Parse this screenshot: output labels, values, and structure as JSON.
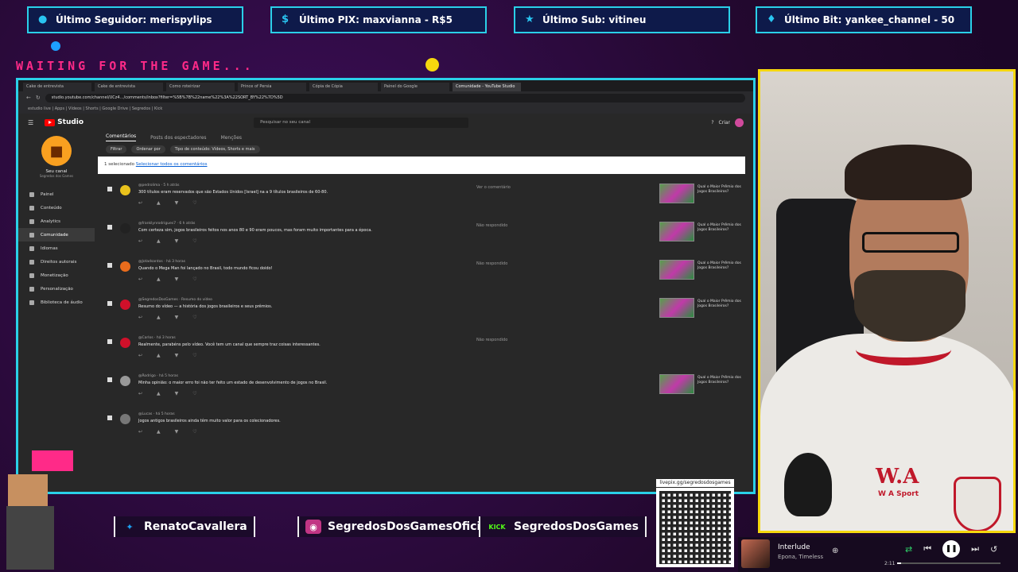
{
  "alerts": [
    {
      "icon": "user-icon",
      "text": "Último Seguidor: merispylips"
    },
    {
      "icon": "pix-icon",
      "text": "Último PIX: maxvianna - R$5"
    },
    {
      "icon": "star-icon",
      "text": "Último Sub: vitineu"
    },
    {
      "icon": "diamond-icon",
      "text": "Último Bit: yankee_channel - 50"
    }
  ],
  "waiting_text": "WAITING FOR THE GAME...",
  "browser": {
    "tabs": [
      "Cake de entrevista",
      "Cake de entrevista",
      "Como roteirizar",
      "Prince of Persia",
      "Cópia de Cópia",
      "Painel do Google",
      "Comunidade - YouTube Studio"
    ],
    "url": "studio.youtube.com/channel/UCz4…/comments/inbox?filter=%5B%7B%22name%22%3A%22SORT_BY%22%7D%5D",
    "bookmarks": "estudio live | Apps | Vídeos | Shorts | Google Drive | Segredos | Kick",
    "studio": {
      "logo": "Studio",
      "search_placeholder": "Pesquisar no seu canal",
      "create": "Criar",
      "channel_name": "Seu canal",
      "channel_sub": "Segredos dos Games",
      "nav": [
        "Painel",
        "Conteúdo",
        "Analytics",
        "Comunidade",
        "Idiomas",
        "Direitos autorais",
        "Monetização",
        "Personalização",
        "Biblioteca de áudio"
      ],
      "subtabs": [
        "Comentários",
        "Posts dos espectadores",
        "Menções"
      ],
      "filters": [
        "Filtrar",
        "Ordenar por",
        "Tipo de conteúdo: Vídeos, Shorts e mais"
      ],
      "banner_prefix": "1 selecionado",
      "banner_link": "Selecionar todos os comentários",
      "comments": [
        {
          "author": "@pedrolima · 5 h atrás",
          "text": "300 títulos eram reservados que são Estados Unidos [Israel] na a 9 títulos brasileiros de 60-80.",
          "status": "Ver o comentário",
          "video": "Qual o Maior Prêmio dos Jogos Brasileiros?",
          "avatar_color": "#e9c21c"
        },
        {
          "author": "@franklynrodrigues7 · 6 h atrás",
          "text": "Com certeza sim, jogos brasileiros feitos nos anos 80 e 90 eram poucos, mas foram muito importantes para a época.",
          "status": "Não respondido",
          "video": "Qual o Maior Prêmio dos Jogos Brasileiros?",
          "avatar_color": "#222"
        },
        {
          "author": "@Jotadsantos · há 3 horas",
          "text": "Quando o Mega Man foi lançado no Brasil, todo mundo ficou doido!",
          "status": "Não respondido",
          "video": "Qual o Maior Prêmio dos Jogos Brasileiros?",
          "avatar_color": "#e96c1c"
        },
        {
          "author": "@SegredosDosGames · Resumo do vídeo",
          "text": "Resumo do vídeo — a história dos jogos brasileiros e seus prêmios.",
          "status": "",
          "video": "Qual o Maior Prêmio dos Jogos Brasileiros?",
          "avatar_color": "#d0102a"
        },
        {
          "author": "@Carlos · há 3 horas",
          "text": "Realmente, parabéns pelo vídeo. Você tem um canal que sempre traz coisas interessantes.",
          "status": "Não respondido",
          "video": "",
          "avatar_color": "#d0102a"
        },
        {
          "author": "@Rodrigo · há 5 horas",
          "text": "Minha opinião: o maior erro foi não ter feito um estado de desenvolvimento de jogos no Brasil.",
          "status": "",
          "video": "Qual o Maior Prêmio dos Jogos Brasileiros?",
          "avatar_color": "#999"
        },
        {
          "author": "@Lucas · há 5 horas",
          "text": "Jogos antigos brasileiros ainda têm muito valor para os colecionadores.",
          "status": "",
          "video": "",
          "avatar_color": "#777"
        }
      ]
    }
  },
  "socials": [
    {
      "icon": "twitter-icon",
      "name": "RenatoCavallera",
      "color": "#1da1f2"
    },
    {
      "icon": "instagram-icon",
      "name": "SegredosDosGamesOficial",
      "color": "#c13584"
    },
    {
      "icon": "kick-icon",
      "name": "SegredosDosGames",
      "color": "#53fc18",
      "badge": "KICK"
    }
  ],
  "qr_label": "livepix.gg/segredosdosgames",
  "webcam": {
    "brand": "W.A",
    "brand_sub": "W A Sport"
  },
  "player": {
    "song": "Interlude",
    "artist": "Epona, Timeless",
    "time": "2:11",
    "progress": 0.04
  }
}
